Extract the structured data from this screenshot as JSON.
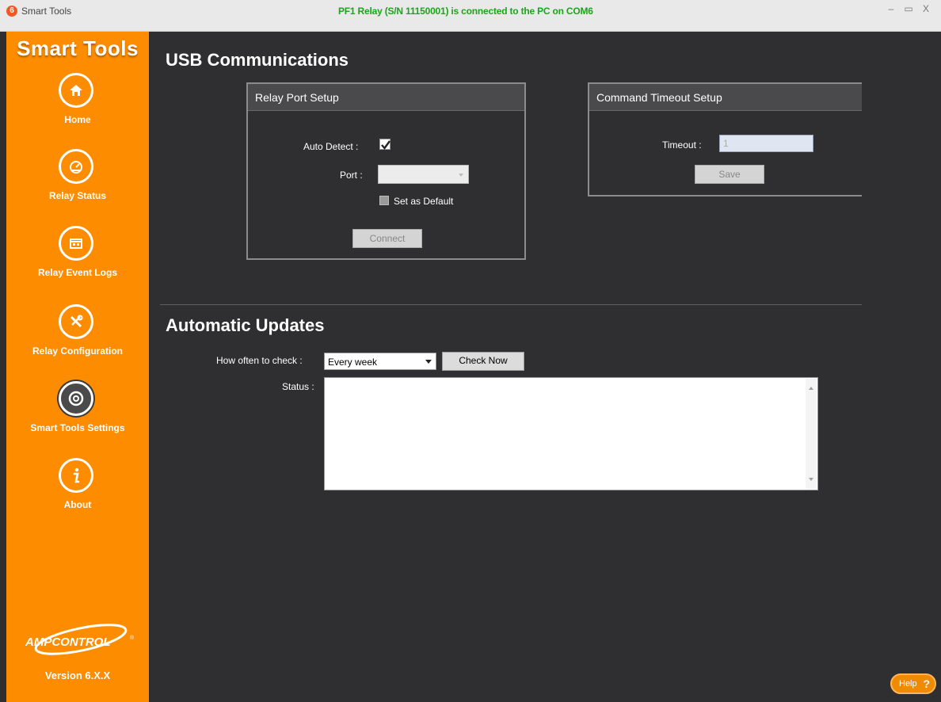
{
  "window": {
    "app_title": "Smart Tools",
    "logo_char": "6",
    "connection_status": "PF1 Relay (S/N 11150001) is connected to the PC on COM6",
    "minimize": "–",
    "maximize": "▭",
    "close": "X"
  },
  "sidebar": {
    "brand": "Smart Tools",
    "items": [
      {
        "label": "Home",
        "icon": "home-icon"
      },
      {
        "label": "Relay Status",
        "icon": "gauge-icon"
      },
      {
        "label": "Relay Event Logs",
        "icon": "calendar-icon"
      },
      {
        "label": "Relay Configuration",
        "icon": "tools-icon"
      },
      {
        "label": "Smart Tools Settings",
        "icon": "settings-icon",
        "active": true
      },
      {
        "label": "About",
        "icon": "info-icon"
      }
    ],
    "company_logo": "AMPCONTROL",
    "version": "Version 6.X.X"
  },
  "usb": {
    "heading": "USB Communications",
    "relay_port": {
      "title": "Relay Port Setup",
      "auto_detect_label": "Auto Detect :",
      "auto_detect_checked": true,
      "port_label": "Port :",
      "port_value": "",
      "set_default_label": "Set as Default",
      "connect_label": "Connect"
    },
    "timeout": {
      "title": "Command Timeout Setup",
      "timeout_label": "Timeout :",
      "timeout_value": "1",
      "save_label": "Save"
    }
  },
  "updates": {
    "heading": "Automatic Updates",
    "frequency_label": "How often to check :",
    "frequency_value": "Every week",
    "check_now_label": "Check Now",
    "status_label": "Status :",
    "status_text": ""
  },
  "help": {
    "label": "Help",
    "icon": "?"
  },
  "colors": {
    "sidebar": "#fd8c00",
    "background": "#2f2f31",
    "status_green": "#1aa51a"
  }
}
